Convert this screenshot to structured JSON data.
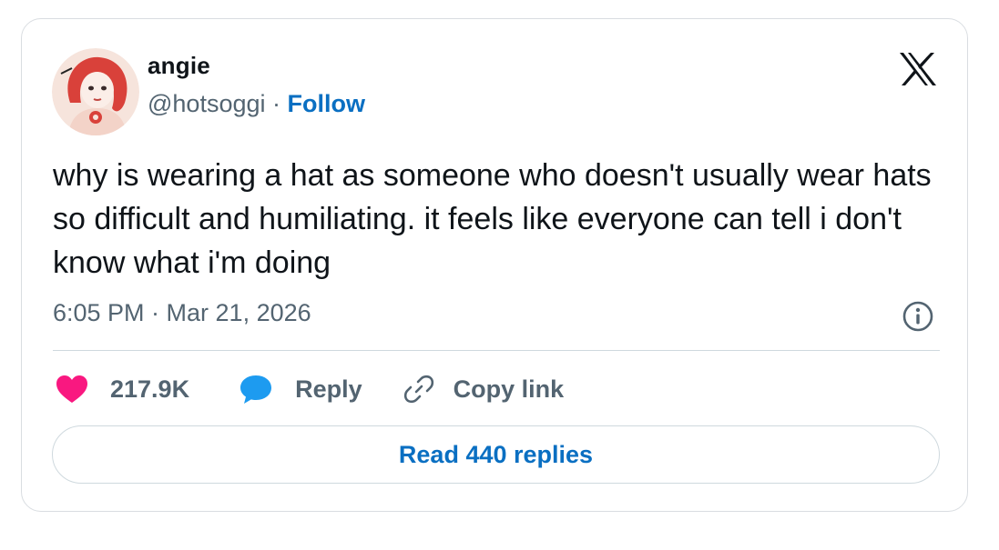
{
  "tweet": {
    "author": {
      "display_name": "angie",
      "handle": "@hotsoggi",
      "separator": " · ",
      "follow_label": "Follow"
    },
    "text": "why is wearing a hat as someone who doesn't usually wear hats so difficult and humiliating. it feels like everyone can tell i don't know what i'm doing",
    "timestamp": "6:05 PM · Mar 21, 2026"
  },
  "actions": {
    "like_count": "217.9K",
    "reply_label": "Reply",
    "copy_link_label": "Copy link"
  },
  "read_replies_label": "Read 440 replies",
  "icons": {
    "like": "heart-icon",
    "reply": "speech-bubble-icon",
    "copy_link": "link-icon",
    "info": "info-icon",
    "brand": "x-logo-icon"
  },
  "colors": {
    "link_blue": "#0a6fc2",
    "like_pink": "#f91880",
    "reply_blue": "#1d9bf0",
    "text_primary": "#0f1419",
    "text_secondary": "#536471"
  }
}
